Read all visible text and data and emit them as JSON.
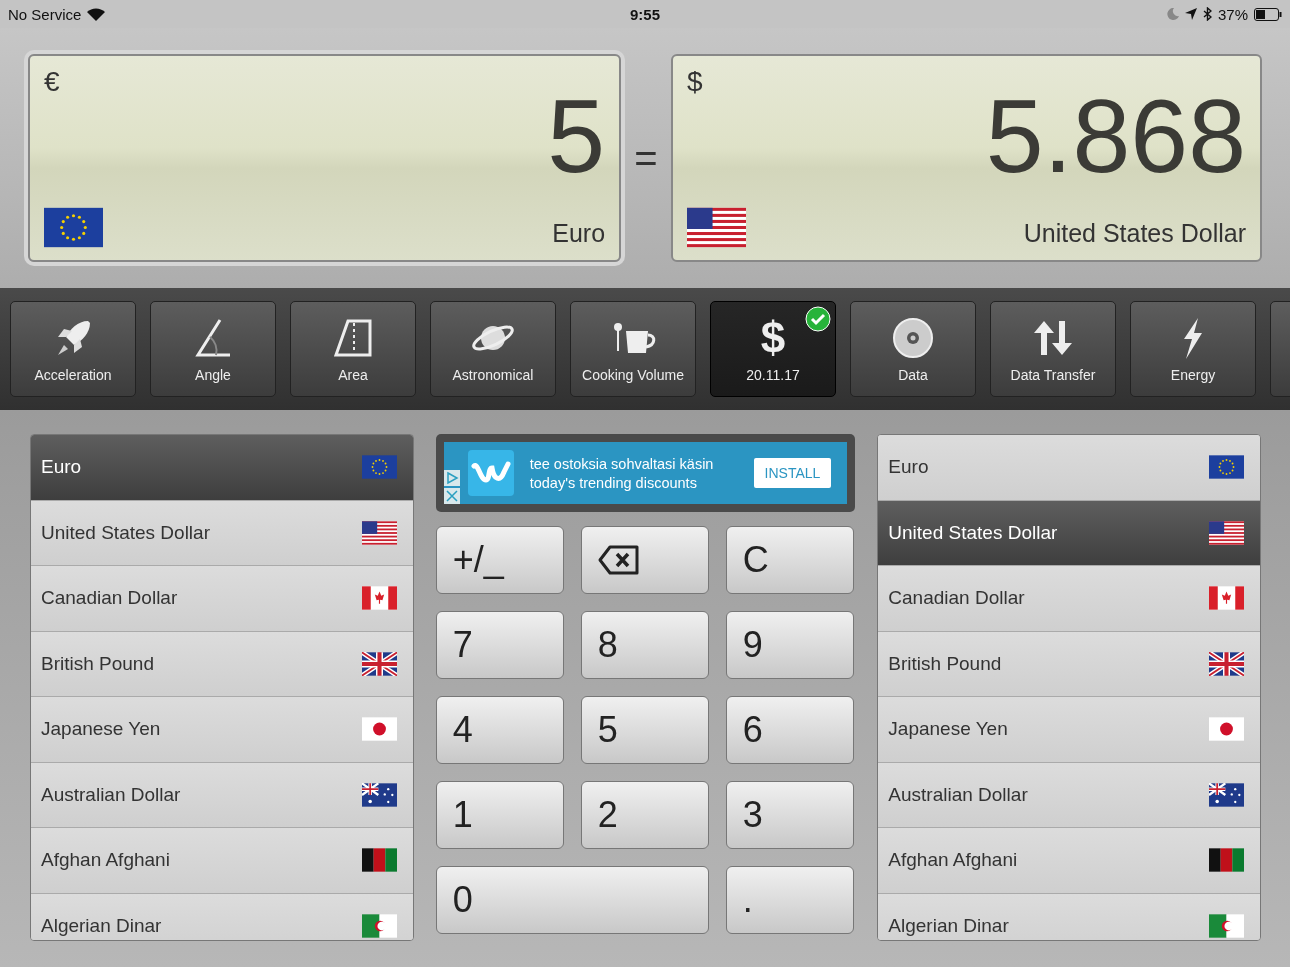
{
  "status_bar": {
    "carrier": "No Service",
    "time": "9:55",
    "battery": "37%"
  },
  "from_display": {
    "symbol": "€",
    "value": "5",
    "currency": "Euro",
    "flag": {
      "kind": "eu"
    }
  },
  "equals": "=",
  "to_display": {
    "symbol": "$",
    "value": "5.868",
    "currency": "United States Dollar",
    "flag": {
      "kind": "us"
    }
  },
  "categories": [
    {
      "kind": "rocket",
      "label": "Acceleration",
      "selected": false
    },
    {
      "kind": "angle",
      "label": "Angle",
      "selected": false
    },
    {
      "kind": "area",
      "label": "Area",
      "selected": false
    },
    {
      "kind": "planet",
      "label": "Astronomical",
      "selected": false
    },
    {
      "kind": "cup",
      "label": "Cooking Volume",
      "selected": false
    },
    {
      "kind": "glyph",
      "glyph": "$",
      "label": "20.11.17",
      "selected": true
    },
    {
      "kind": "disc",
      "label": "Data",
      "selected": false
    },
    {
      "kind": "arrows",
      "label": "Data Transfer",
      "selected": false
    },
    {
      "kind": "bolt",
      "label": "Energy",
      "selected": false
    }
  ],
  "ad": {
    "line_1": "tee ostoksia sohvaltasi käsin",
    "line_2": "today's trending discounts",
    "button": "INSTALL"
  },
  "keypad": [
    {
      "kind": "text",
      "label": "+/_"
    },
    {
      "kind": "backspace"
    },
    {
      "kind": "text",
      "label": "C"
    },
    {
      "kind": "text",
      "label": "7"
    },
    {
      "kind": "text",
      "label": "8"
    },
    {
      "kind": "text",
      "label": "9"
    },
    {
      "kind": "text",
      "label": "4"
    },
    {
      "kind": "text",
      "label": "5"
    },
    {
      "kind": "text",
      "label": "6"
    },
    {
      "kind": "text",
      "label": "1"
    },
    {
      "kind": "text",
      "label": "2"
    },
    {
      "kind": "text",
      "label": "3"
    },
    {
      "kind": "wide",
      "label": "0"
    },
    {
      "kind": "text",
      "label": "."
    }
  ],
  "from_list": [
    {
      "name": "Euro",
      "kind": "eu",
      "selected": true
    },
    {
      "name": "United States Dollar",
      "kind": "us",
      "selected": false
    },
    {
      "name": "Canadian Dollar",
      "kind": "ca",
      "selected": false
    },
    {
      "name": "British Pound",
      "kind": "gb",
      "selected": false
    },
    {
      "name": "Japanese Yen",
      "kind": "jp",
      "selected": false
    },
    {
      "name": "Australian Dollar",
      "kind": "au",
      "selected": false
    },
    {
      "name": "Afghan Afghani",
      "kind": "af",
      "selected": false
    },
    {
      "name": "Algerian Dinar",
      "kind": "dz",
      "selected": false
    }
  ],
  "to_list": [
    {
      "name": "Euro",
      "kind": "eu",
      "selected": false
    },
    {
      "name": "United States Dollar",
      "kind": "us",
      "selected": true
    },
    {
      "name": "Canadian Dollar",
      "kind": "ca",
      "selected": false
    },
    {
      "name": "British Pound",
      "kind": "gb",
      "selected": false
    },
    {
      "name": "Japanese Yen",
      "kind": "jp",
      "selected": false
    },
    {
      "name": "Australian Dollar",
      "kind": "au",
      "selected": false
    },
    {
      "name": "Afghan Afghani",
      "kind": "af",
      "selected": false
    },
    {
      "name": "Algerian Dinar",
      "kind": "dz",
      "selected": false
    }
  ]
}
